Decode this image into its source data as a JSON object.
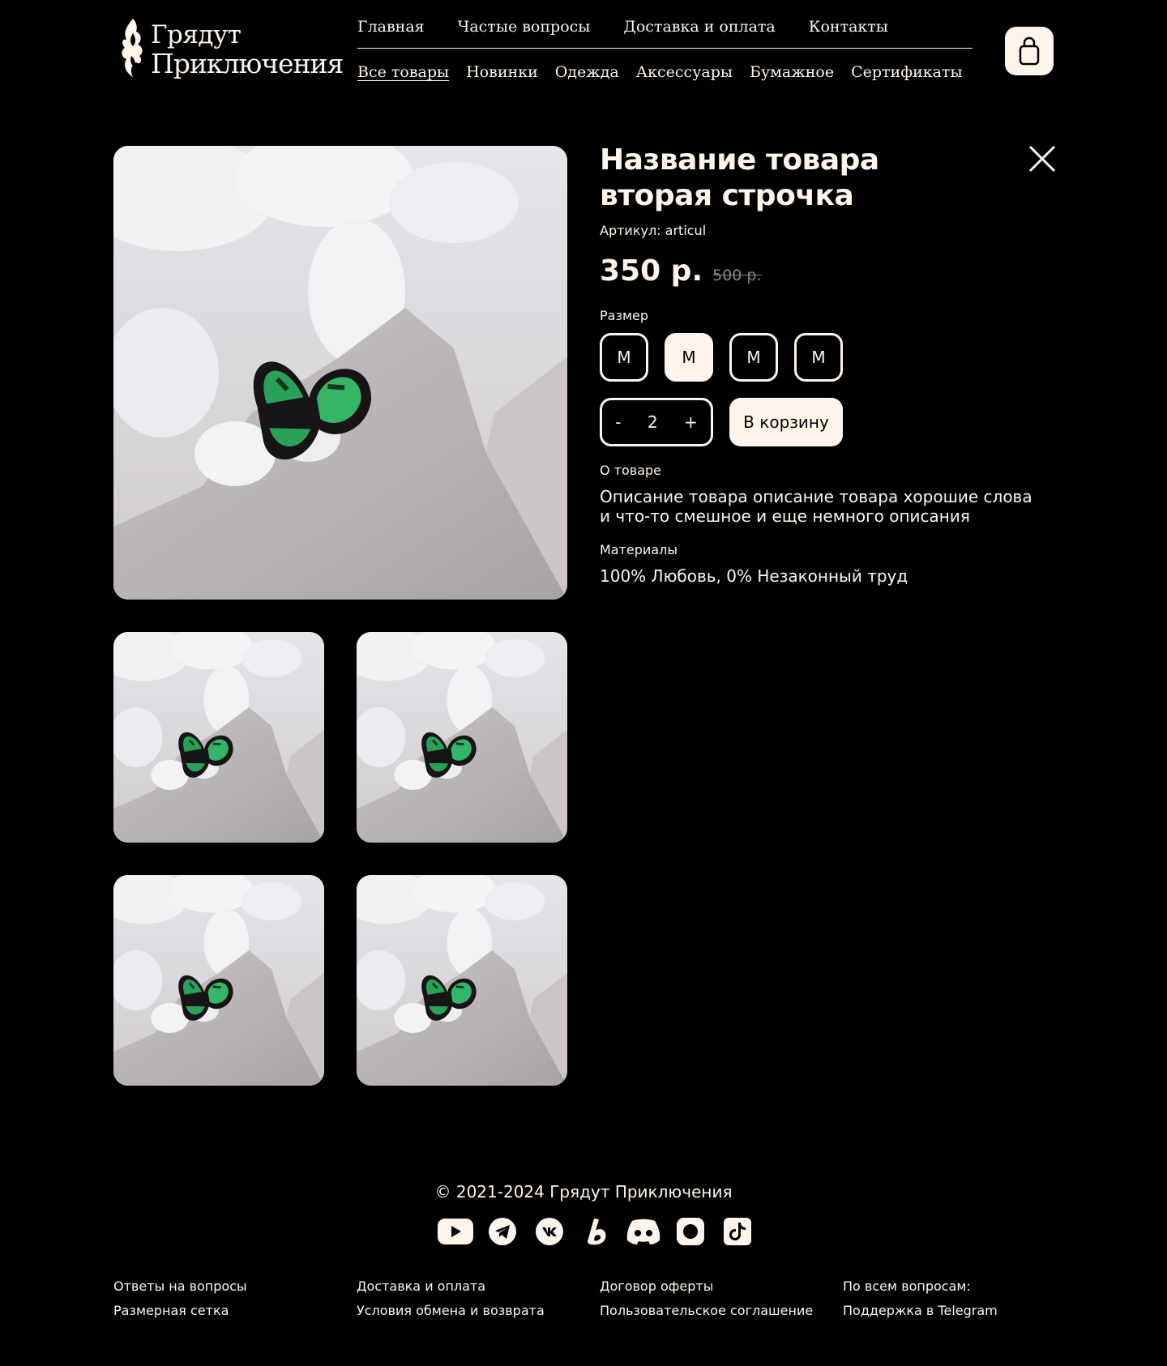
{
  "brand": {
    "line1": "Грядут",
    "line2": "Приключения"
  },
  "nav": {
    "top": [
      "Главная",
      "Частые вопросы",
      "Доставка и оплата",
      "Контакты"
    ],
    "categories": [
      "Все товары",
      "Новинки",
      "Одежда",
      "Аксессуары",
      "Бумажное",
      "Сертификаты"
    ],
    "active_category": "Все товары"
  },
  "cart_icon": "shopping-bag-icon",
  "product": {
    "title_line1": "Название товара",
    "title_line2": "вторая строчка",
    "sku": "Артикул: articul",
    "price": "350 р.",
    "old_price": "500 р.",
    "size_label": "Размер",
    "sizes": [
      "M",
      "M",
      "M",
      "M"
    ],
    "selected_size_index": 1,
    "qty_minus": "-",
    "quantity": "2",
    "qty_plus": "+",
    "add_to_cart": "В корзину",
    "about_label": "О товаре",
    "about_text": "Описание товара описание товара хорошие слова и что-то смешное и еще немного описания",
    "materials_label": "Материалы",
    "materials_text": "100% Любовь, 0% Незаконный труд"
  },
  "footer": {
    "copyright": "© 2021-2024 Грядут Приключения",
    "socials": [
      "youtube-icon",
      "telegram-icon",
      "vk-icon",
      "boosty-icon",
      "discord-icon",
      "instagram-icon",
      "tiktok-icon"
    ],
    "col1": [
      "Ответы на вопросы",
      "Размерная сетка"
    ],
    "col2": [
      "Доставка и оплата",
      "Условия обмена и возврата"
    ],
    "col3": [
      "Договор оферты",
      "Пользовательское соглашение"
    ],
    "col4": [
      "По всем вопросам:",
      "Поддержка в Telegram"
    ]
  },
  "colors": {
    "background": "#000000",
    "cream": "#fff4ea",
    "butterfly": "#2aa05a"
  }
}
